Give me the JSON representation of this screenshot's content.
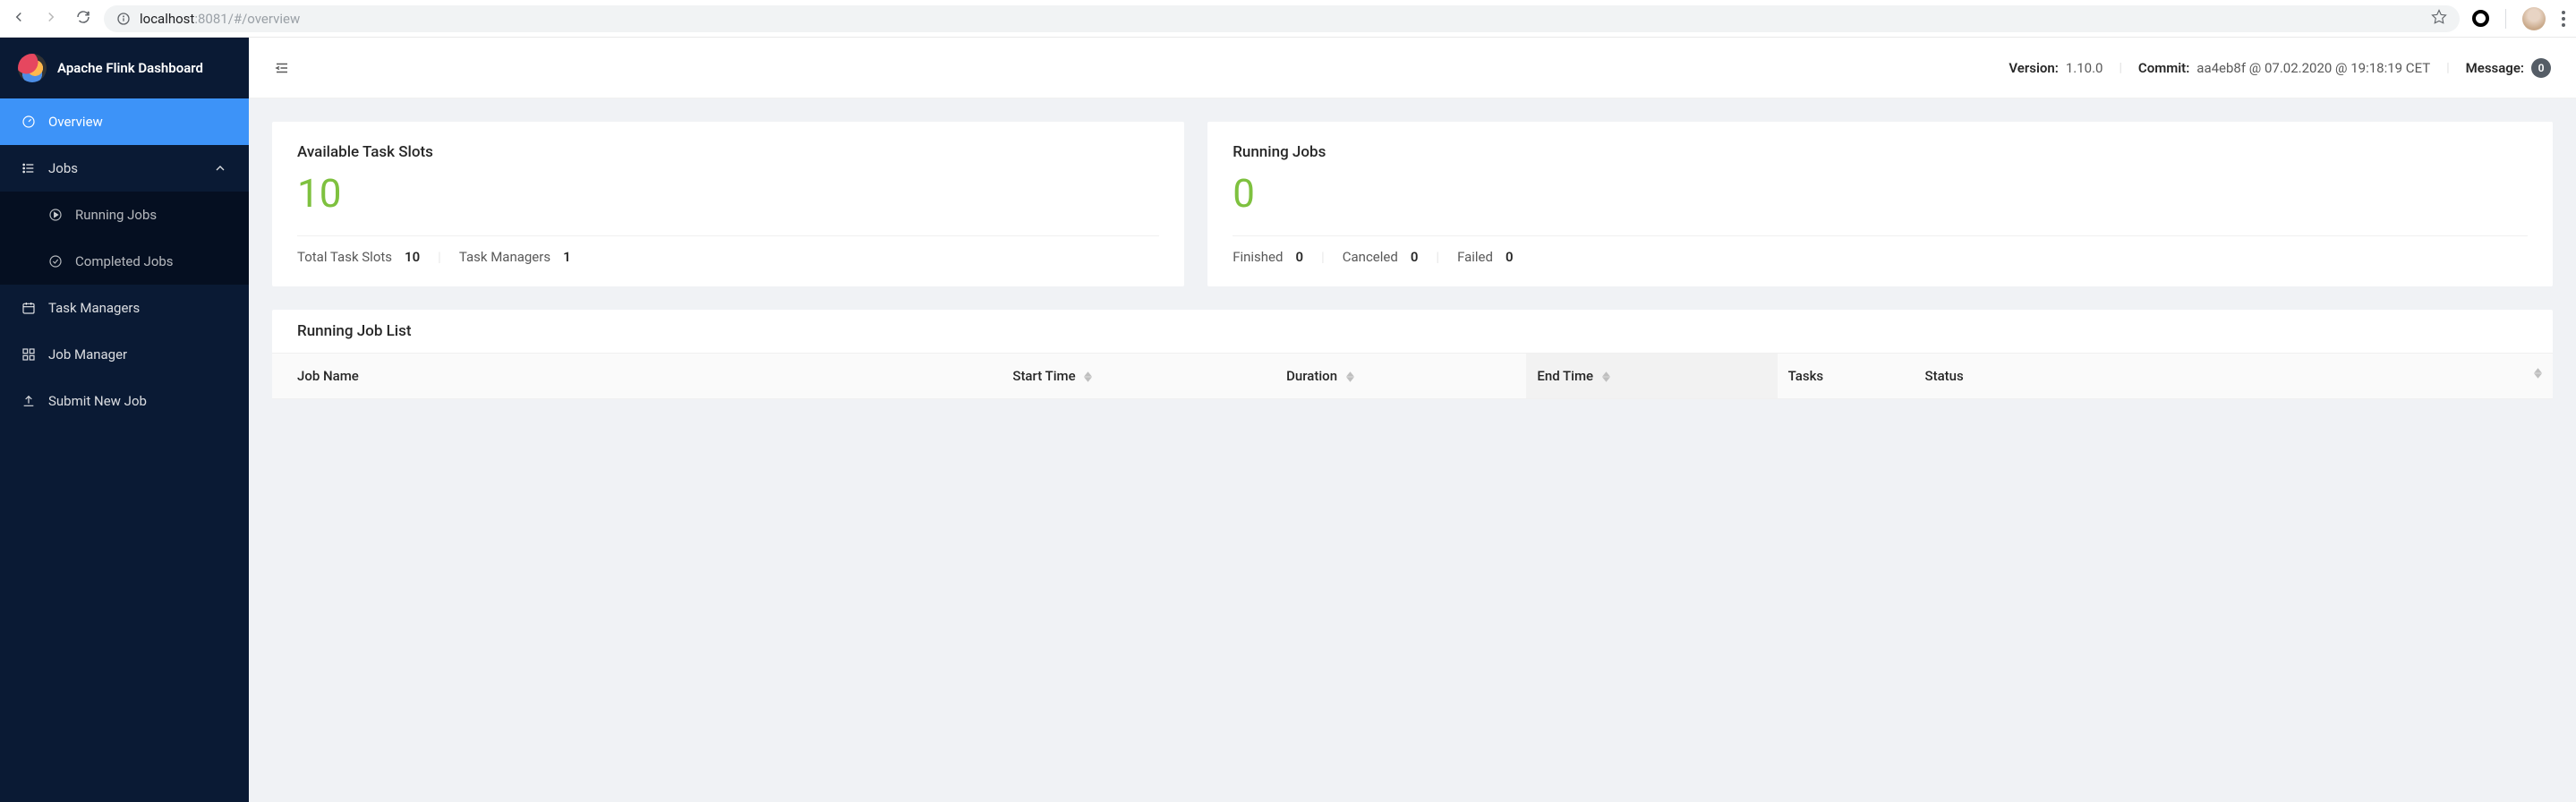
{
  "browser": {
    "url": {
      "host": "localhost",
      "port": ":8081",
      "path": "/#/overview"
    }
  },
  "app_title": "Apache Flink Dashboard",
  "sidebar": {
    "overview": "Overview",
    "jobs": "Jobs",
    "running_jobs": "Running Jobs",
    "completed_jobs": "Completed Jobs",
    "task_managers": "Task Managers",
    "job_manager": "Job Manager",
    "submit_new_job": "Submit New Job"
  },
  "topbar": {
    "version_label": "Version:",
    "version_value": "1.10.0",
    "commit_label": "Commit:",
    "commit_value": "aa4eb8f @ 07.02.2020 @ 19:18:19 CET",
    "message_label": "Message:",
    "message_badge": "0"
  },
  "slots_card": {
    "title": "Available Task Slots",
    "value": "10",
    "total_label": "Total Task Slots",
    "total_value": "10",
    "tm_label": "Task Managers",
    "tm_value": "1"
  },
  "jobs_card": {
    "title": "Running Jobs",
    "value": "0",
    "finished_label": "Finished",
    "finished_value": "0",
    "canceled_label": "Canceled",
    "canceled_value": "0",
    "failed_label": "Failed",
    "failed_value": "0"
  },
  "job_list": {
    "title": "Running Job List",
    "cols": {
      "job_name": "Job Name",
      "start_time": "Start Time",
      "duration": "Duration",
      "end_time": "End Time",
      "tasks": "Tasks",
      "status": "Status"
    }
  }
}
